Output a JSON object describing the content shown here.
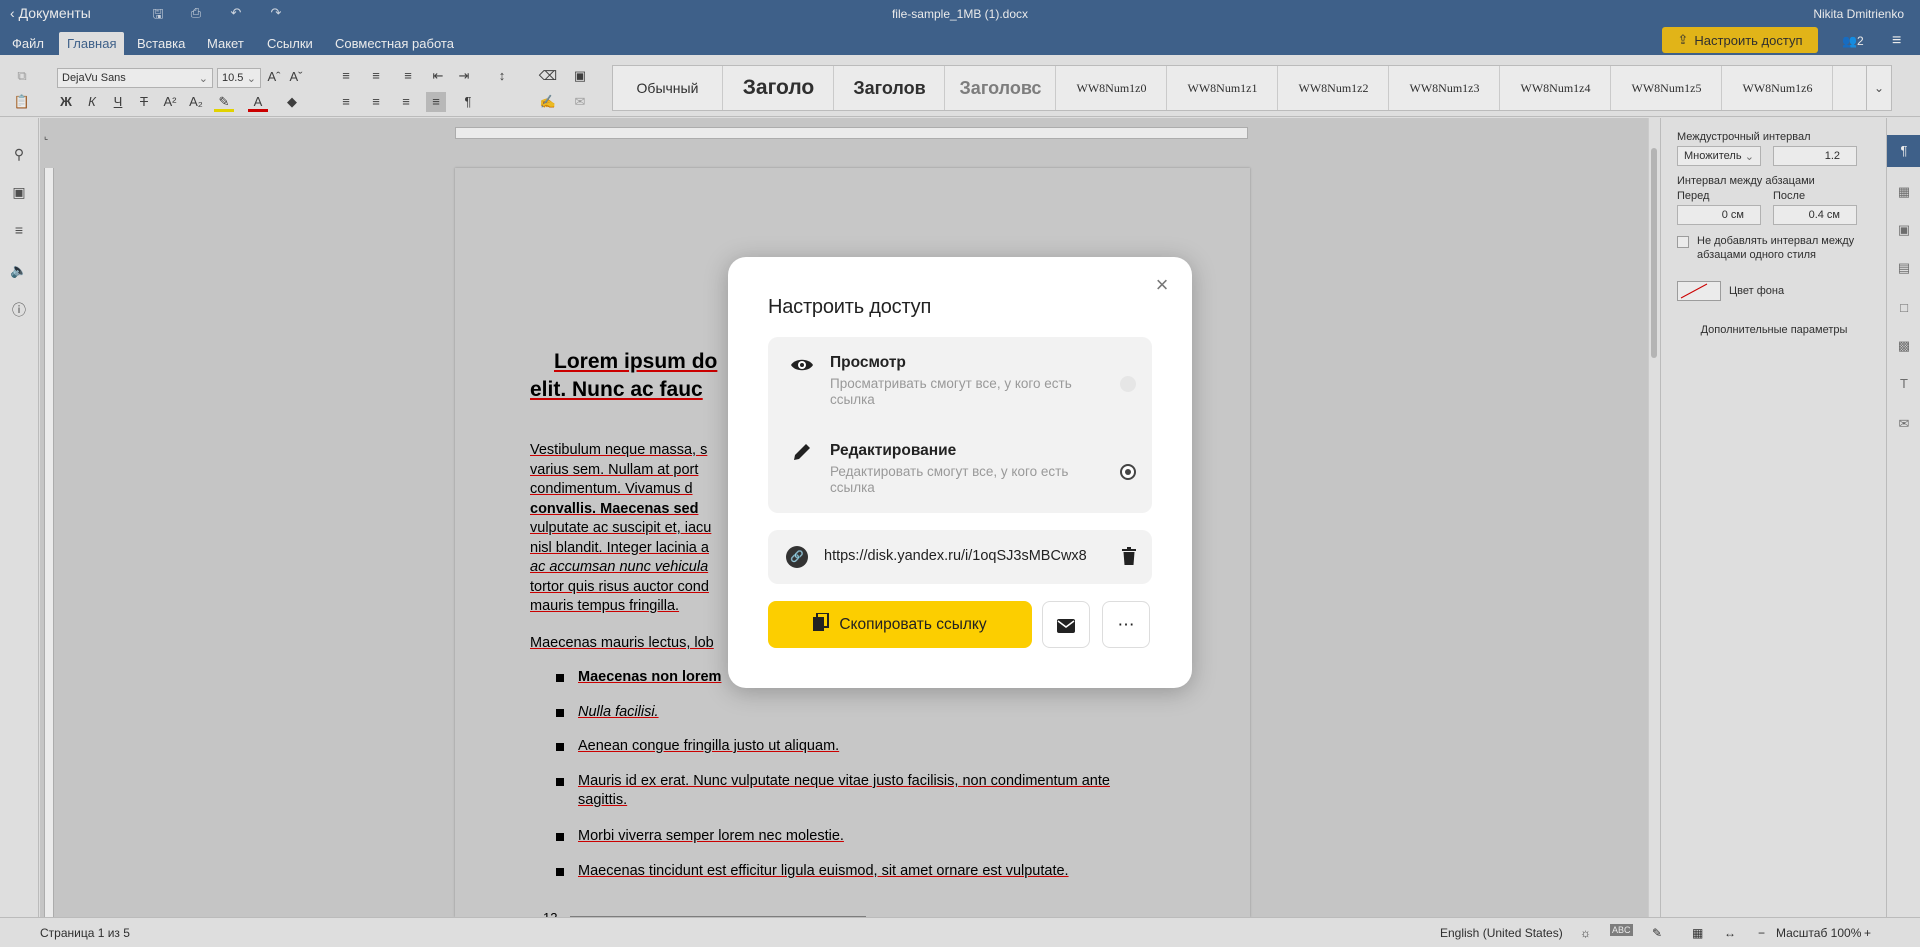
{
  "titlebar": {
    "back_label": "Документы",
    "doc_title": "file-sample_1MB (1).docx",
    "user": "Nikita Dmitrienko"
  },
  "menu": {
    "tabs": [
      "Файл",
      "Главная",
      "Вставка",
      "Макет",
      "Ссылки",
      "Совместная работа"
    ],
    "active_tab": "Главная",
    "share_label": "Настроить доступ",
    "users_count": "2"
  },
  "toolbar": {
    "font_name": "DejaVu Sans",
    "font_size": "10.5",
    "styles": [
      "Обычный",
      "Заголо",
      "Заголов",
      "Заголовс",
      "WW8Num1z0",
      "WW8Num1z1",
      "WW8Num1z2",
      "WW8Num1z3",
      "WW8Num1z4",
      "WW8Num1z5",
      "WW8Num1z6"
    ]
  },
  "document": {
    "heading_line1": "Lorem ipsum do",
    "heading_line2": "elit. Nunc ac fauc",
    "para1": [
      "Vestibulum neque massa, s",
      "varius sem. Nullam at port",
      "condimentum. Vivamus d",
      "convallis. Maecenas sed",
      "vulputate ac suscipit et, iacu",
      "nisl blandit. Integer lacinia a",
      "ac accumsan nunc vehicula",
      "tortor quis risus auctor cond",
      "mauris tempus fringilla."
    ],
    "para2": "Maecenas mauris lectus, lob",
    "bullets": [
      "Maecenas non lorem",
      "Nulla facilisi.",
      "Aenean congue fringilla justo ut aliquam.",
      "Mauris id ex erat. Nunc vulputate neque vitae justo facilisis, non condimentum ante",
      "sagittis.",
      "Morbi viverra semper lorem nec molestie.",
      "Maecenas tincidunt est efficitur ligula euismod, sit amet ornare est vulputate."
    ],
    "table_num": "12"
  },
  "right_panel": {
    "line_spacing_label": "Междустрочный интервал",
    "line_spacing_type": "Множитель",
    "line_spacing_value": "1.2",
    "para_spacing_label": "Интервал между абзацами",
    "before_label": "Перед",
    "after_label": "После",
    "before_value": "0 см",
    "after_value": "0.4 см",
    "no_spacing_label_1": "Не добавлять интервал между",
    "no_spacing_label_2": "абзацами одного стиля",
    "bg_color_label": "Цвет фона",
    "advanced_label": "Дополнительные параметры"
  },
  "statusbar": {
    "page": "Страница 1 из 5",
    "language": "English (United States)",
    "zoom": "Масштаб 100%"
  },
  "modal": {
    "title": "Настроить доступ",
    "view_title": "Просмотр",
    "view_desc_1": "Просматривать смогут все, у кого есть",
    "view_desc_2": "ссылка",
    "edit_title": "Редактирование",
    "edit_desc_1": "Редактировать смогут все, у кого есть",
    "edit_desc_2": "ссылка",
    "selected": "edit",
    "link_url": "https://disk.yandex.ru/i/1oqSJ3sMBCwx8",
    "copy_label": "Скопировать ссылку"
  }
}
